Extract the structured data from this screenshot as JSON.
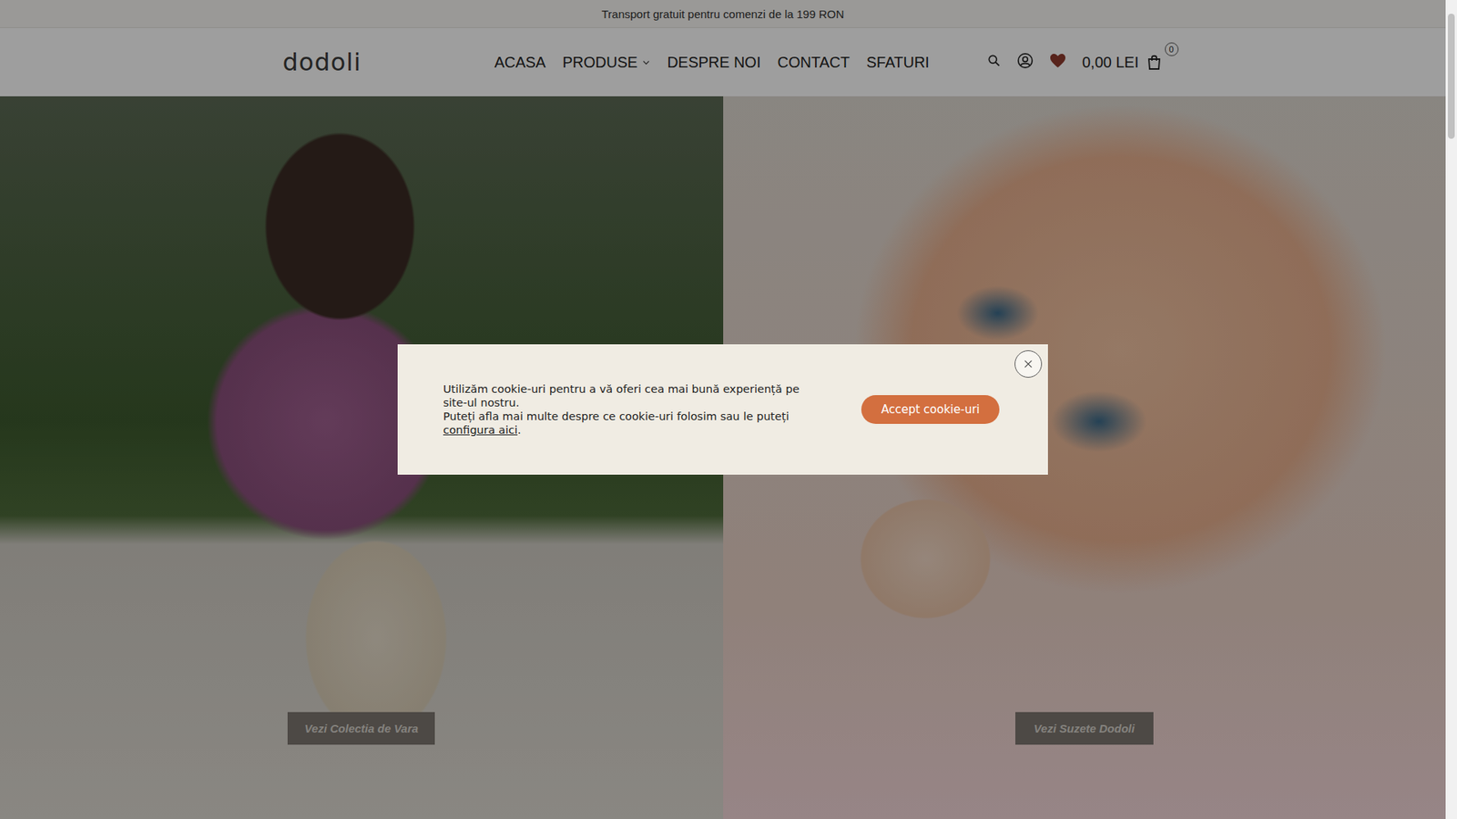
{
  "topbar": {
    "text": "Transport gratuit pentru comenzi de la 199 RON"
  },
  "header": {
    "logo": "dodoli",
    "nav": [
      {
        "label": "ACASA",
        "kind": "link"
      },
      {
        "label": "PRODUSE",
        "kind": "dropdown"
      },
      {
        "label": "DESPRE NOI",
        "kind": "link"
      },
      {
        "label": "CONTACT",
        "kind": "link"
      },
      {
        "label": "SFATURI",
        "kind": "link"
      }
    ],
    "cart": {
      "total": "0,00 LEI",
      "count": "0"
    }
  },
  "hero": [
    {
      "button": "Vezi Colectia de Vara"
    },
    {
      "button": "Vezi Suzete Dodoli"
    }
  ],
  "cookie_dialog": {
    "line1": "Utilizăm cookie-uri pentru a vă oferi cea mai bună experiență pe site-ul nostru.",
    "line2": "Puteți afla mai multe despre ce cookie-uri folosim sau le puteți ",
    "link": "configura aici",
    "line2_end": ".",
    "button": "Accept cookie-uri"
  }
}
